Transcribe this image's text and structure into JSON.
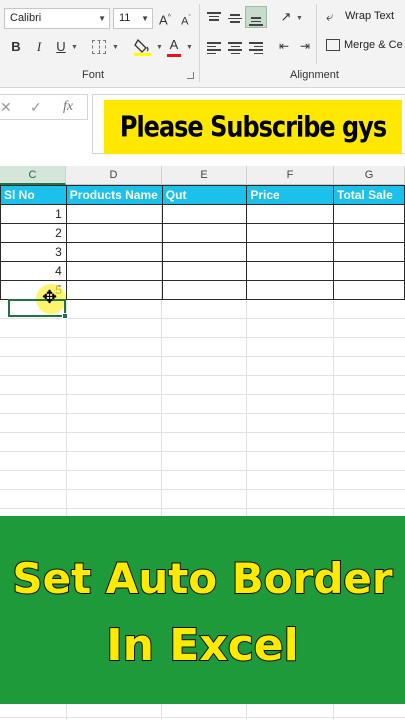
{
  "ribbon": {
    "font_name": "Calibri",
    "font_size": "11",
    "increase_font": "A",
    "decrease_font": "A",
    "bold": "B",
    "italic": "I",
    "underline": "U",
    "font_color_letter": "A",
    "highlight_color": "#ffff00",
    "font_color": "#e81123",
    "wrap_text": "Wrap Text",
    "merge_center": "Merge & Ce",
    "group_font": "Font",
    "group_alignment": "Alignment"
  },
  "formula_bar": {
    "cancel_icon": "close-icon",
    "enter_icon": "check-icon",
    "function_label": "fx"
  },
  "overlay": {
    "subscribe_text": "Please Subscribe gys",
    "subscribe_bg": "#ffe800"
  },
  "sheet": {
    "columns": [
      "C",
      "D",
      "E",
      "F",
      "G"
    ],
    "active_column": "C",
    "headers": [
      "Sl No",
      "Products Name",
      "Qut",
      "Price",
      "Total Sale"
    ],
    "header_color": "#1bc1ea",
    "rows": [
      [
        "1",
        "",
        "",
        "",
        ""
      ],
      [
        "2",
        "",
        "",
        "",
        ""
      ],
      [
        "3",
        "",
        "",
        "",
        ""
      ],
      [
        "4",
        "",
        "",
        "",
        ""
      ],
      [
        "5",
        "",
        "",
        "",
        ""
      ]
    ]
  },
  "banner": {
    "line1": "Set Auto Border",
    "line2": "In Excel",
    "bg_color": "#1f9a3a",
    "text_color": "#ffea00"
  }
}
